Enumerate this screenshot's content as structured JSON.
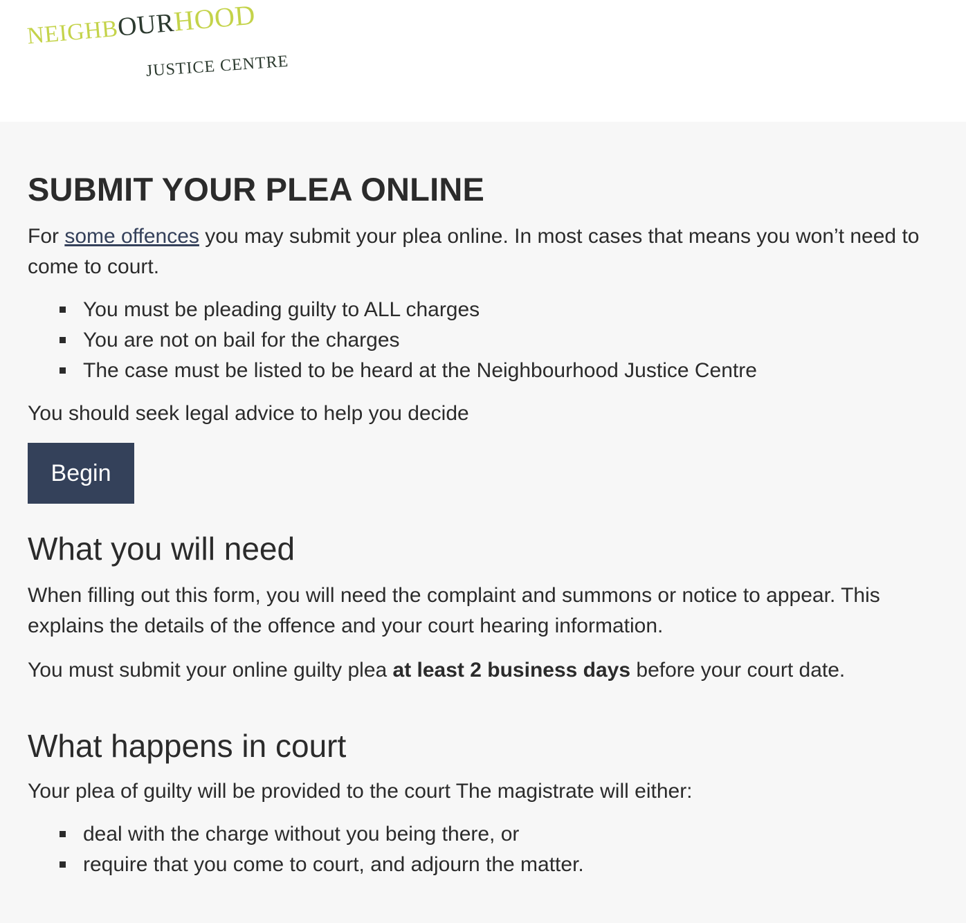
{
  "header": {
    "logo": {
      "word1_part1": "NEIGHB",
      "word1_part2": "OUR",
      "word1_part3": "HOOD",
      "word2": "JUSTICE CENTRE"
    }
  },
  "main": {
    "title": "SUBMIT YOUR PLEA ONLINE",
    "intro": {
      "prefix": "For ",
      "link_text": "some offences",
      "suffix": " you may submit your plea online. In most cases that means you won’t need to come to court."
    },
    "requirements": [
      "You must be pleading guilty to ALL charges",
      "You are not on bail for the charges",
      "The case must be listed to be heard at the Neighbourhood Justice Centre"
    ],
    "advice": "You should seek legal advice to help you decide",
    "begin_label": "Begin",
    "need_section": {
      "heading": "What you will need",
      "paragraph1": "When filling out this form, you will need the complaint and summons or notice to appear. This explains the details of the offence and your court hearing information.",
      "paragraph2_prefix": "You must submit your online guilty plea ",
      "paragraph2_bold": "at least 2 business days",
      "paragraph2_suffix": " before your court date."
    },
    "court_section": {
      "heading": "What happens in court",
      "paragraph": "Your plea of guilty will be provided to the court The magistrate will either:",
      "options": [
        "deal with the charge without you being there, or",
        "require that you come to court, and adjourn the matter."
      ]
    }
  },
  "colors": {
    "logo_green": "#c4d34a",
    "logo_dark": "#2c3a2f",
    "button_bg": "#34415a",
    "link": "#34405a",
    "content_bg": "#f7f7f7"
  }
}
